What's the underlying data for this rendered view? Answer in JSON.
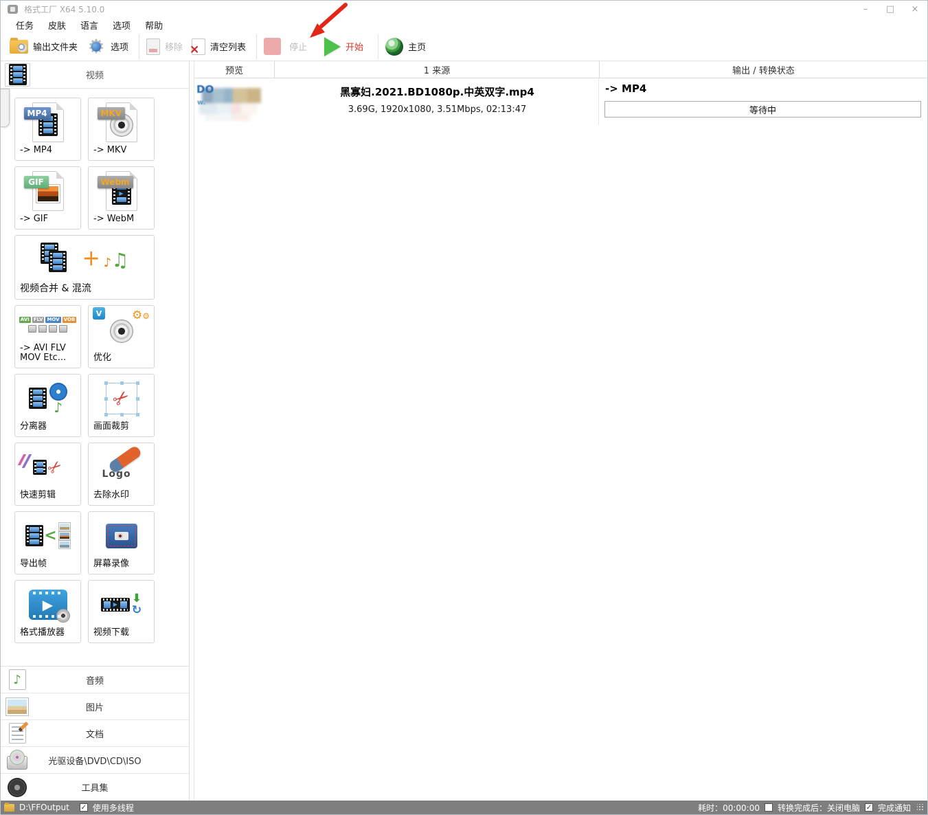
{
  "window": {
    "title": "格式工厂 X64 5.10.0",
    "controls": {
      "minimize": "–",
      "maximize": "□",
      "close": "×"
    }
  },
  "menu": {
    "items": [
      "任务",
      "皮肤",
      "语言",
      "选项",
      "帮助"
    ]
  },
  "toolbar": {
    "output_folder": "输出文件夹",
    "options": "选项",
    "remove": "移除",
    "clear_list": "清空列表",
    "stop": "停止",
    "start": "开始",
    "home": "主页"
  },
  "sidebar": {
    "header": "视频",
    "cells": [
      {
        "label": "-> MP4",
        "badge": "MP4"
      },
      {
        "label": "-> MKV",
        "badge": "MKV"
      },
      {
        "label": "-> GIF",
        "badge": "GIF"
      },
      {
        "label": "-> WebM",
        "badge": "Webm"
      },
      {
        "label": "视频合并 & 混流"
      },
      {
        "label": "-> AVI FLV MOV Etc...",
        "mini_badges": [
          "AVI",
          "FLV",
          "MOV",
          "VOB"
        ]
      },
      {
        "label": "优化",
        "corner_badge": "V"
      },
      {
        "label": "分离器"
      },
      {
        "label": "画面裁剪"
      },
      {
        "label": "快速剪辑"
      },
      {
        "label": "去除水印",
        "eraser_text": "Logo"
      },
      {
        "label": "导出帧"
      },
      {
        "label": "屏幕录像"
      },
      {
        "label": "格式播放器"
      },
      {
        "label": "视频下载"
      }
    ],
    "sections": [
      "音频",
      "图片",
      "文档",
      "光驱设备\\DVD\\CD\\ISO",
      "工具集"
    ]
  },
  "table": {
    "headers": {
      "preview": "预览",
      "source": "1 来源",
      "output": "输出 / 转换状态"
    },
    "row": {
      "thumb_text_top": "DO",
      "thumb_text_bottom": "w.",
      "filename": "黑寡妇.2021.BD1080p.中英双字.mp4",
      "details": "3.69G, 1920x1080, 3.51Mbps, 02:13:47",
      "output": "-> MP4",
      "status": "等待中"
    }
  },
  "statusbar": {
    "output_path": "D:\\FFOutput",
    "multithread_label": "使用多线程",
    "multithread_checked": true,
    "elapsed_label": "耗时：00:00:00",
    "shutdown_label": "转换完成后：关闭电脑",
    "shutdown_checked": false,
    "notify_label": "完成通知",
    "notify_checked": true
  },
  "colors": {
    "accent-red": "#d9352a",
    "start-green": "#4cc24c",
    "stop-pink": "#ecaaaa",
    "statusbar-bg": "#7e7e7e",
    "border": "#d9d9d9"
  }
}
